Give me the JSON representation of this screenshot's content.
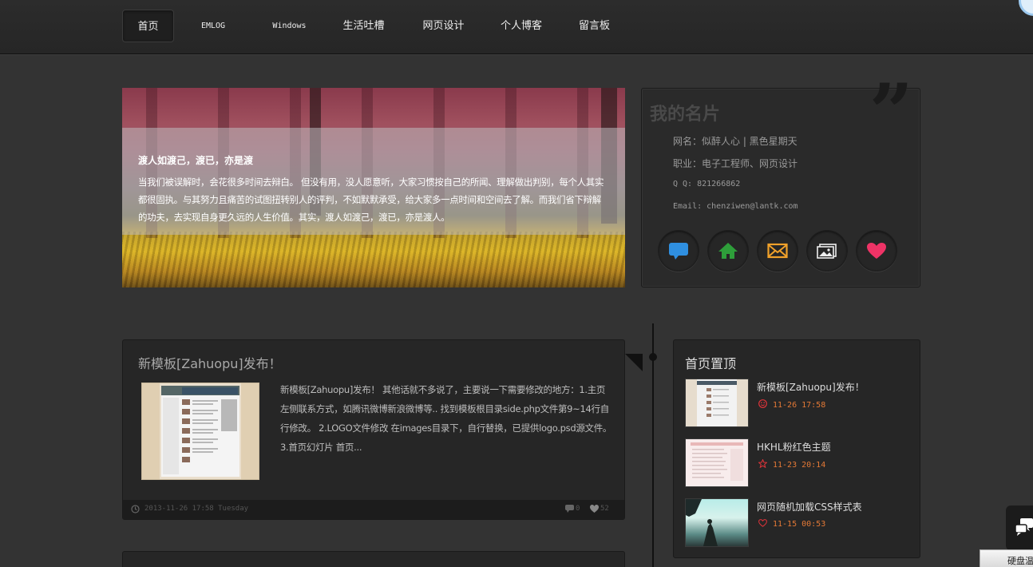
{
  "nav": {
    "items": [
      {
        "label": "首页",
        "active": true
      },
      {
        "label": "EMLOG"
      },
      {
        "label": "Windows"
      },
      {
        "label": "生活吐槽"
      },
      {
        "label": "网页设计"
      },
      {
        "label": "个人博客"
      },
      {
        "label": "留言板"
      }
    ]
  },
  "banner": {
    "title": "渡人如渡己，渡已，亦是渡",
    "text": "当我们被误解时，会花很多时间去辩白。 但没有用，没人愿意听，大家习惯按自己的所闻、理解做出判别，每个人其实都很固执。与其努力且痛苦的试图扭转别人的评判，不如默默承受，给大家多一点时间和空间去了解。而我们省下辩解的功夫，去实现自身更久远的人生价值。其实，渡人如渡己，渡已，亦是渡人。"
  },
  "card": {
    "title": "我的名片",
    "rows": [
      "网名：似醉人心 | 黑色星期天",
      "职业：电子工程师、网页设计",
      "Q Q: 821266862",
      "Email: chenziwen@lantk.com"
    ],
    "icons": [
      "chat-bubble-icon",
      "home-icon",
      "mail-icon",
      "photo-icon",
      "heart-icon"
    ],
    "icon_colors": [
      "#2f8fe0",
      "#2e9e3a",
      "#f0a12a",
      "#eeeeee",
      "#ee3366"
    ]
  },
  "post": {
    "title": "新模板[Zahuopu]发布！",
    "excerpt": "新模板[Zahuopu]发布！ 其他话就不多说了，主要说一下需要修改的地方：1.主页左侧联系方式，如腾讯微博新浪微博等.. 找到模板根目录side.php文件第9~14行自行修改。 2.LOGO文件修改 在images目录下，自行替换，已提供logo.psd源文件。 3.首页幻灯片 首页...",
    "date": "2013-11-26 17:58 Tuesday",
    "comments": "0",
    "likes": "52"
  },
  "sidebar": {
    "title": "首页置顶",
    "items": [
      {
        "name": "新模板[Zahuopu]发布！",
        "date": "11-26 17:58",
        "icon": "smiley-icon"
      },
      {
        "name": "HKHL粉红色主题",
        "date": "11-23 20:14",
        "icon": "star-icon"
      },
      {
        "name": "网页随机加载CSS样式表",
        "date": "11-15 00:53",
        "icon": "heart-outline-icon"
      }
    ]
  },
  "widgets": {
    "disk_label": "硬盘温"
  }
}
